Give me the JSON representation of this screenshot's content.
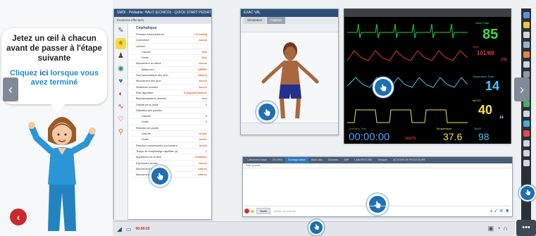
{
  "tutorial": {
    "message": "Jetez un œil à chacun avant de passer à l'étape suivante",
    "cta_word": "ici",
    "cta_before": "Cliquez ",
    "cta_after": " lorsque vous avez terminé"
  },
  "exam_window": {
    "title": "SMDI - Pédiatrie: HALO (ECNICO) - QUICK START PEDIATRIC",
    "header": "Examens effectués",
    "section": "Céphalique",
    "rows": [
      {
        "label": "Pression intracrânienne",
        "value": "7.5 mmHg",
        "indent": false
      },
      {
        "label": "Convulsion",
        "value": "Aucun",
        "indent": false
      },
      {
        "label": "Larmes",
        "value": "",
        "indent": false
      },
      {
        "label": "Gauche",
        "value": "Non",
        "indent": true
      },
      {
        "label": "Droite",
        "value": "Non",
        "indent": true
      },
      {
        "label": "Mouvement au talent",
        "value": "Aucun",
        "indent": false
      },
      {
        "label": "Bâillement",
        "value": "ARRÊT",
        "indent": true
      },
      {
        "label": "Saut automatique des yeux",
        "value": "Absent",
        "indent": false
      },
      {
        "label": "Mouvement des yeux",
        "value": "Aucun",
        "indent": false
      },
      {
        "label": "Strabisme oculaire",
        "value": "Aucun",
        "indent": false
      },
      {
        "label": "État clignotant",
        "value": "5 clignements/min",
        "indent": false
      },
      {
        "label": "Blépharospasme (double)",
        "value": "Non",
        "indent": false
      },
      {
        "label": "Gravité de la ptose",
        "value": "0",
        "indent": false
      },
      {
        "label": "Dilatation des pupilles",
        "value": "",
        "indent": false
      },
      {
        "label": "Gauche",
        "value": "5",
        "indent": true
      },
      {
        "label": "Droite",
        "value": "5",
        "indent": true
      },
      {
        "label": "Réaction de pupille",
        "value": "",
        "indent": false
      },
      {
        "label": "Gauche",
        "value": "Active",
        "indent": true
      },
      {
        "label": "Droite",
        "value": "Active",
        "indent": true
      },
      {
        "label": "Réaction consensuelle à la lumière",
        "value": "Active",
        "indent": false
      },
      {
        "label": "Temps de remplissage capillaire (s)",
        "value": "2",
        "indent": false
      },
      {
        "label": "Apparence de la face",
        "value": "Ordinaire",
        "indent": false
      },
      {
        "label": "Expression faciale",
        "value": "Aucun",
        "indent": false
      },
      {
        "label": "Mouvement de la bouche",
        "value": "Altérée",
        "indent": false
      },
      {
        "label": "Mouvement du cou",
        "value": "Altérée",
        "indent": false
      }
    ]
  },
  "patient_window": {
    "title": "EXAC VAL",
    "tabs": [
      "Simulation",
      "Capture"
    ]
  },
  "monitor": {
    "hr_label": "Heart Rate",
    "hr": "85",
    "nibp_label": "NIBP",
    "nibp": "101/69",
    "nibp_mean": "(79)",
    "rr_label": "Respiratory Rate",
    "rr": "14",
    "etco2_label": "etCO2",
    "etco2": "40",
    "etco2_sub": "14",
    "timer_label": "Scenario Time",
    "timer": "00:00:00",
    "bp_small": "101/73",
    "temp_label": "Temperature",
    "temp": "37.6",
    "spo2_label": "SpO2",
    "spo2": "98",
    "colors": {
      "ecg": "#28d03a",
      "hr": "#34e24a",
      "nibp": "#e53935",
      "rr": "#4fc3f7",
      "etco2": "#f2e64a",
      "timer": "#4fa3ff",
      "temp": "#f2e64a",
      "spo2": "#4fc3f7"
    }
  },
  "journal": {
    "tabs": [
      "Lancement buste",
      "CELERA",
      "Sondage virtuel",
      "Bilan labo",
      "Donnees",
      "SBP",
      "LABORATOIRE",
      "Marquer",
      "ACTIONS DE PROCEDURE"
    ],
    "sub_label": "Filter journal",
    "send_label": "Noter",
    "placeholder": "Ajouter au journal"
  },
  "taskbar": {
    "clock": "00:00:02"
  }
}
